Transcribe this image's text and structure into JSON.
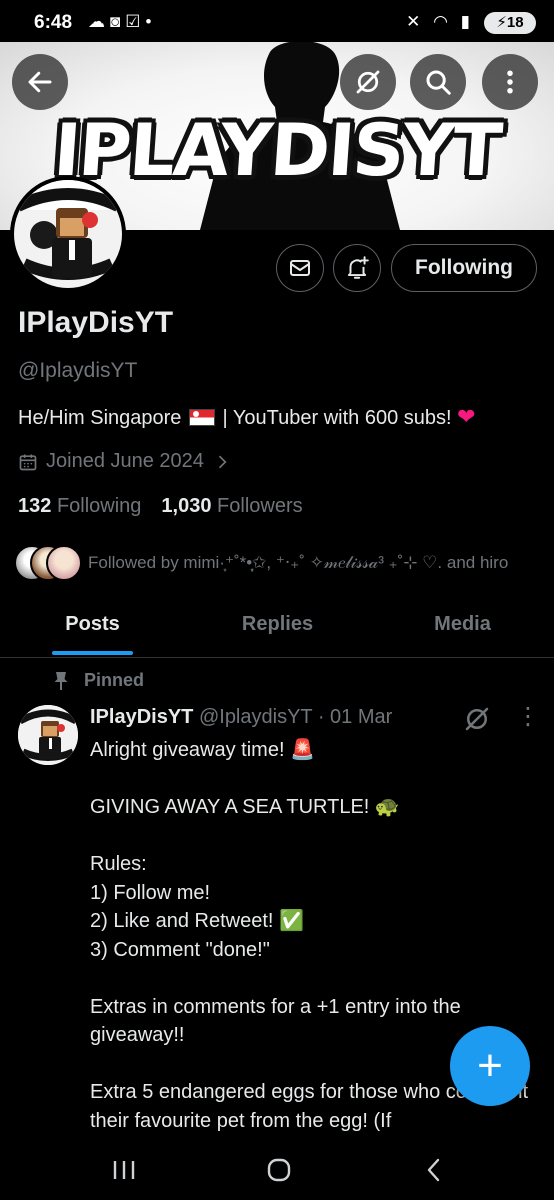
{
  "status_bar": {
    "time": "6:48",
    "left_icons": [
      "weather-icon",
      "discord-icon",
      "checkbox-icon",
      "dot-icon"
    ],
    "right_icons": [
      "mute-icon",
      "wifi-icon",
      "signal-icon"
    ],
    "battery": "18"
  },
  "banner": {
    "text": "IPLAYDISYT"
  },
  "profile": {
    "following_button_label": "Following",
    "display_name": "IPlayDisYT",
    "handle": "@IplaydisYT",
    "bio_before_flag": "He/Him Singapore",
    "bio_after_flag": " | YouTuber with 600 subs! ",
    "bio_emoji": "❤",
    "joined": "Joined June 2024",
    "following_count": "132",
    "following_label": "Following",
    "followers_count": "1,030",
    "followers_label": "Followers",
    "followed_by": "Followed by mimi·͙⁺˚*•̩̩͙✩, ⁺‧₊˚ ✧𝓂𝑒𝓁𝒾𝓈𝓈𝒶³ ₊˚⊹ ♡. and hiro"
  },
  "tabs": [
    {
      "label": "Posts",
      "active": true
    },
    {
      "label": "Replies",
      "active": false
    },
    {
      "label": "Media",
      "active": false
    }
  ],
  "post": {
    "pinned_label": "Pinned",
    "author_name": "IPlayDisYT",
    "author_handle": "@IplaydisYT",
    "separator": " · ",
    "date": "01 Mar",
    "body": "Alright giveaway time! 🚨\n\nGIVING AWAY A SEA TURTLE! 🐢\n\nRules:\n1) Follow me!\n2) Like and Retweet! ✅\n3) Comment \"done!\"\n\nExtras in comments for a +1 entry into the giveaway!!\n\nExtra 5 endangered eggs for those who comment their favourite pet from the egg! (If"
  },
  "fab_label": "+",
  "colors": {
    "accent": "#1d9bf0",
    "text_primary": "#e7e9ea",
    "text_secondary": "#71767b",
    "background": "#000000",
    "heart": "#f91880"
  }
}
